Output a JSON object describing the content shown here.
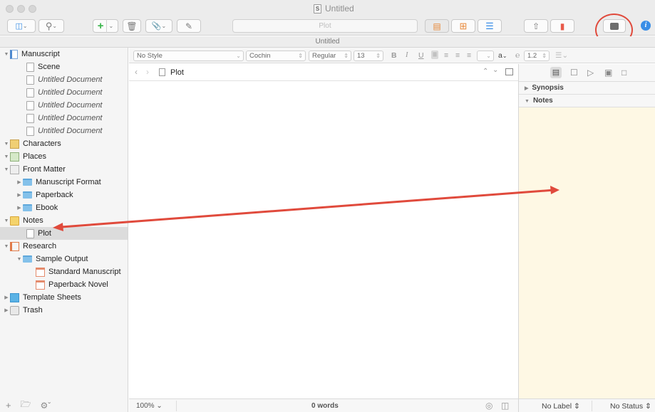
{
  "window": {
    "title": "Untitled",
    "doc_title_bar": "Untitled"
  },
  "toolbar": {
    "search_field_placeholder": "Plot"
  },
  "binder": {
    "items": [
      {
        "label": "Manuscript"
      },
      {
        "label": "Scene"
      },
      {
        "label": "Untitled Document"
      },
      {
        "label": "Untitled Document"
      },
      {
        "label": "Untitled Document"
      },
      {
        "label": "Untitled Document"
      },
      {
        "label": "Untitled Document"
      },
      {
        "label": "Characters"
      },
      {
        "label": "Places"
      },
      {
        "label": "Front Matter"
      },
      {
        "label": "Manuscript Format"
      },
      {
        "label": "Paperback"
      },
      {
        "label": "Ebook"
      },
      {
        "label": "Notes"
      },
      {
        "label": "Plot"
      },
      {
        "label": "Research"
      },
      {
        "label": "Sample Output"
      },
      {
        "label": "Standard Manuscript"
      },
      {
        "label": "Paperback Novel"
      },
      {
        "label": "Template Sheets"
      },
      {
        "label": "Trash"
      }
    ]
  },
  "format_bar": {
    "style": "No Style",
    "font": "Cochin",
    "weight": "Regular",
    "size": "13",
    "line_spacing": "1.2",
    "bold": "B",
    "italic": "I",
    "underline": "U",
    "text_color": "a"
  },
  "editor": {
    "header_title": "Plot",
    "zoom": "100%",
    "word_count": "0 words"
  },
  "inspector": {
    "synopsis_label": "Synopsis",
    "notes_label": "Notes",
    "label_select": "No Label",
    "status_select": "No Status"
  },
  "colors": {
    "accent_blue": "#3a8ee6",
    "annotation_red": "#e04a3c",
    "notes_bg": "#fef8e4"
  }
}
